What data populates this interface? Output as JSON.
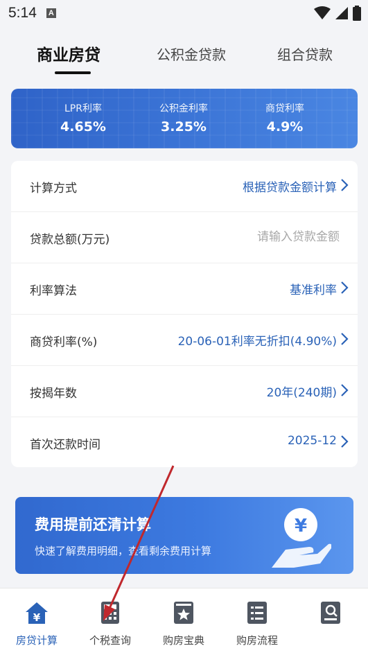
{
  "status_bar": {
    "time": "5:14",
    "badge": "A"
  },
  "tabs": [
    {
      "label": "商业房贷",
      "active": true
    },
    {
      "label": "公积金贷款",
      "active": false
    },
    {
      "label": "组合贷款",
      "active": false
    }
  ],
  "rates": [
    {
      "label": "LPR利率",
      "value": "4.65%"
    },
    {
      "label": "公积金利率",
      "value": "3.25%"
    },
    {
      "label": "商贷利率",
      "value": "4.9%"
    }
  ],
  "form": {
    "calc_method": {
      "label": "计算方式",
      "value": "根据贷款金额计算"
    },
    "loan_amount": {
      "label": "贷款总额(万元)",
      "placeholder": "请输入贷款金额",
      "value": ""
    },
    "rate_method": {
      "label": "利率算法",
      "value": "基准利率"
    },
    "commercial_rate": {
      "label": "商贷利率(%)",
      "value": "20-06-01利率无折扣(4.90%)"
    },
    "years": {
      "label": "按揭年数",
      "value": "20年(240期)"
    },
    "first_payment": {
      "label": "首次还款时间",
      "value": "2025-12"
    }
  },
  "promo": {
    "title": "费用提前还清计算",
    "subtitle": "快速了解费用明细，查看剩余费用计算"
  },
  "bottom_nav": [
    {
      "label": "房贷计算",
      "icon": "house-yen-icon",
      "active": true
    },
    {
      "label": "个税查询",
      "icon": "calculator-icon",
      "active": false
    },
    {
      "label": "购房宝典",
      "icon": "star-book-icon",
      "active": false
    },
    {
      "label": "购房流程",
      "icon": "checklist-icon",
      "active": false
    },
    {
      "label": "",
      "icon": "search-doc-icon",
      "active": false
    }
  ],
  "colors": {
    "accent": "#2a62b7",
    "banner": "#3b74d6",
    "annotation_arrow": "#c0282d"
  }
}
